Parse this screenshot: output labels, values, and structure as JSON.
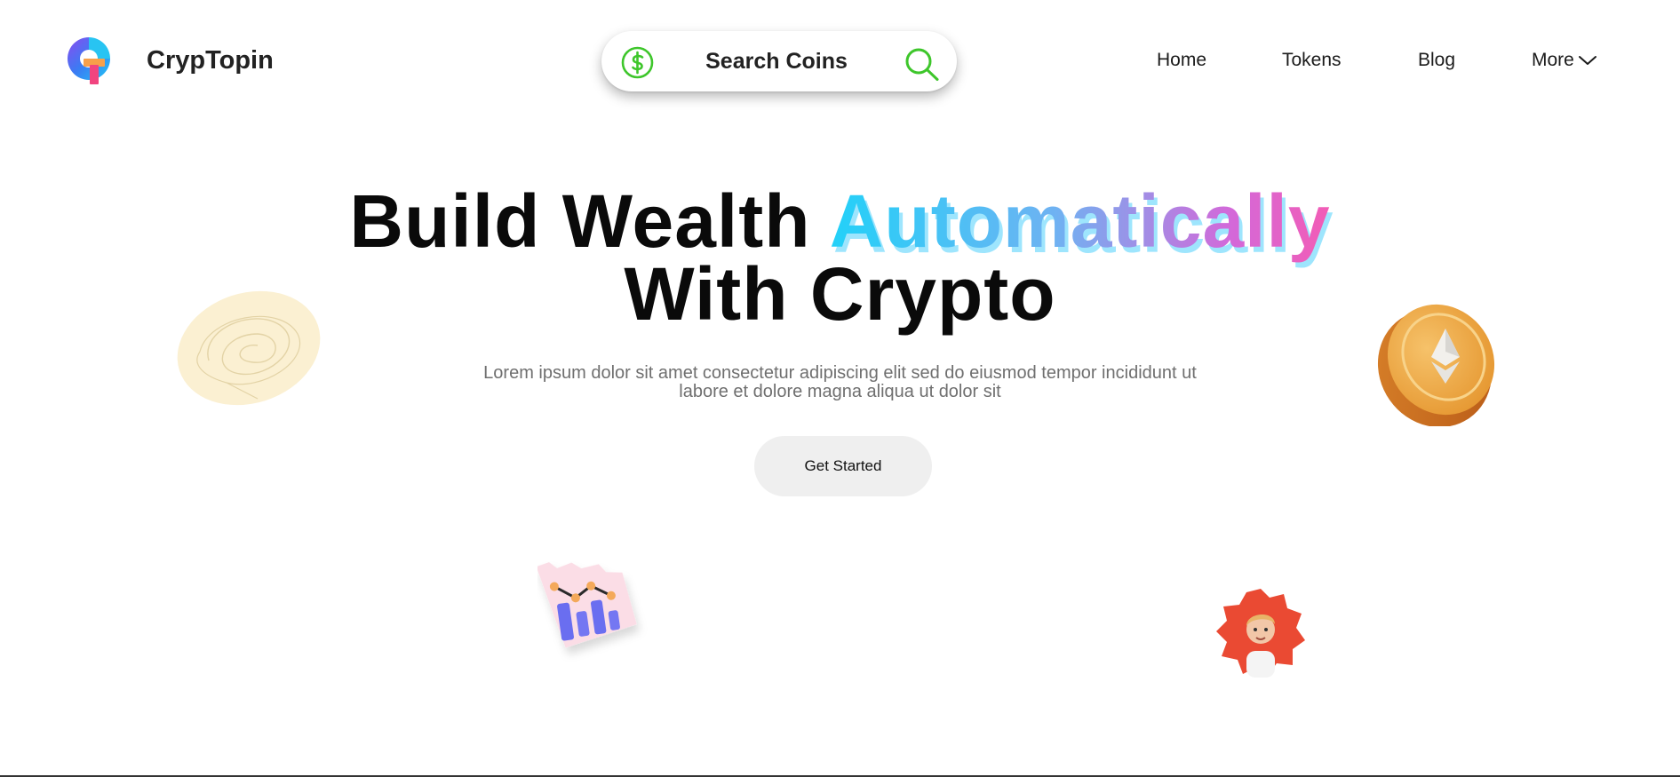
{
  "brand": {
    "name": "CrypTopin",
    "logo_icon": "cryptopin-logo-icon"
  },
  "search": {
    "placeholder": "Search Coins",
    "left_icon": "dollar-circle-icon",
    "right_icon": "search-icon",
    "accent": "#3ec62b"
  },
  "nav": {
    "items": [
      {
        "label": "Home"
      },
      {
        "label": "Tokens"
      },
      {
        "label": "Blog"
      },
      {
        "label": "More",
        "icon": "chevron-down-icon"
      }
    ]
  },
  "hero": {
    "title_part1": "Build Wealth ",
    "title_highlight": "Automatically",
    "title_part2": "With Crypto",
    "subtitle_line1": "Lorem ipsum dolor sit amet consectetur adipiscing elit sed do eiusmod tempor incididunt ut",
    "subtitle_line2": "labore et dolore magna aliqua ut dolor sit",
    "cta_label": "Get Started"
  },
  "decorations": [
    "scribble-blob-icon",
    "ethereum-coin-icon",
    "bar-chart-sticker-icon",
    "person-avatar-badge"
  ],
  "colors": {
    "gradient_start": "#22d1f8",
    "gradient_end": "#f35cb5",
    "coin": "#e08a2e",
    "avatar_badge": "#ea4a33",
    "chart_bars": "#6a6ef0"
  }
}
